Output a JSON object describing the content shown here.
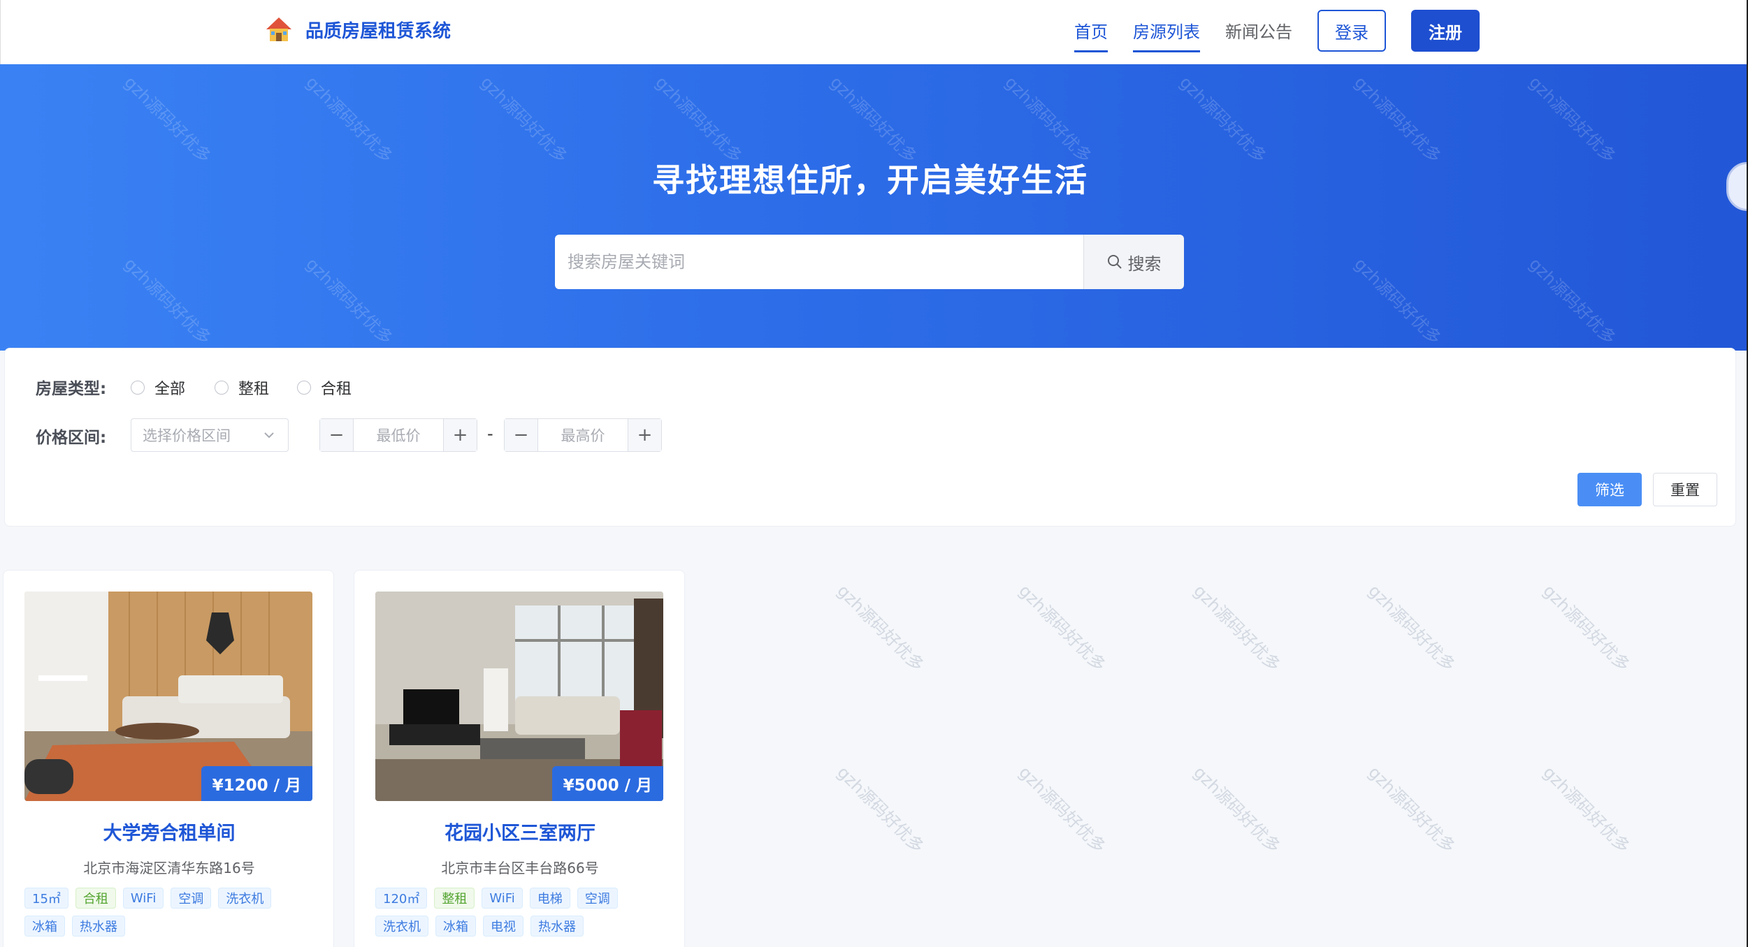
{
  "header": {
    "app_title": "品质房屋租赁系统",
    "nav": [
      {
        "label": "首页",
        "active": true
      },
      {
        "label": "房源列表",
        "active": true
      },
      {
        "label": "新闻公告",
        "active": false
      }
    ],
    "login_label": "登录",
    "register_label": "注册"
  },
  "hero": {
    "title": "寻找理想住所，开启美好生活",
    "search_placeholder": "搜索房屋关键词",
    "search_button": "搜索"
  },
  "filter": {
    "type_label": "房屋类型:",
    "type_options": [
      "全部",
      "整租",
      "合租"
    ],
    "price_label": "价格区间:",
    "price_select_placeholder": "选择价格区间",
    "min_price_placeholder": "最低价",
    "max_price_placeholder": "最高价",
    "range_separator": "-",
    "filter_button": "筛选",
    "reset_button": "重置"
  },
  "listings": [
    {
      "title": "大学旁合租单间",
      "price": "¥1200 / 月",
      "address": "北京市海淀区清华东路16号",
      "tags": [
        {
          "text": "15㎡",
          "type": "info"
        },
        {
          "text": "合租",
          "type": "success"
        },
        {
          "text": "WiFi",
          "type": "info"
        },
        {
          "text": "空调",
          "type": "info"
        },
        {
          "text": "洗衣机",
          "type": "info"
        },
        {
          "text": "冰箱",
          "type": "info"
        },
        {
          "text": "热水器",
          "type": "info"
        }
      ]
    },
    {
      "title": "花园小区三室两厅",
      "price": "¥5000 / 月",
      "address": "北京市丰台区丰台路66号",
      "tags": [
        {
          "text": "120㎡",
          "type": "info"
        },
        {
          "text": "整租",
          "type": "success"
        },
        {
          "text": "WiFi",
          "type": "info"
        },
        {
          "text": "电梯",
          "type": "info"
        },
        {
          "text": "空调",
          "type": "info"
        },
        {
          "text": "洗衣机",
          "type": "info"
        },
        {
          "text": "冰箱",
          "type": "info"
        },
        {
          "text": "电视",
          "type": "info"
        },
        {
          "text": "热水器",
          "type": "info"
        }
      ]
    }
  ],
  "watermark_text": "gzh源码好优多",
  "colors": {
    "primary": "#1e56d6",
    "hero_start": "#3a82f4",
    "hero_end": "#2257d7",
    "success_tag": "#55a532"
  }
}
